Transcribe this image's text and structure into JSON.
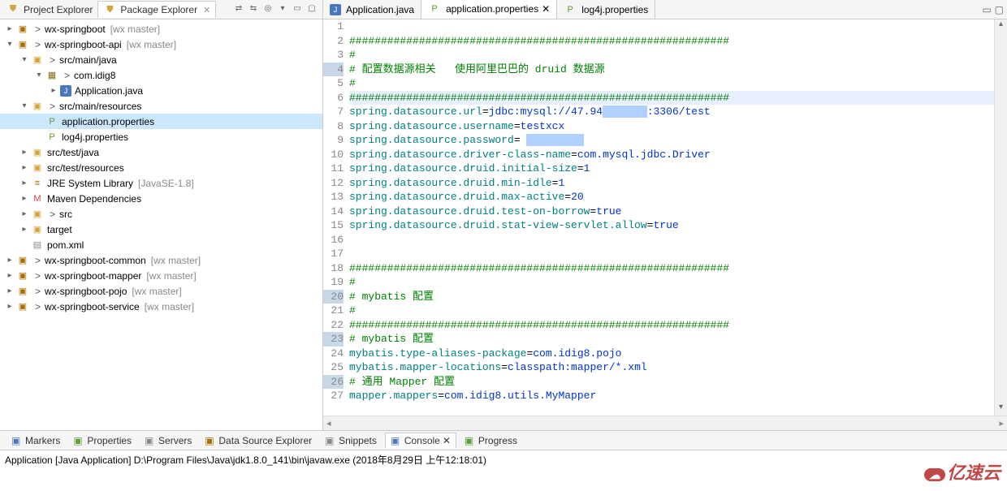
{
  "explorer": {
    "tabs": [
      {
        "label": "Project Explorer",
        "active": false
      },
      {
        "label": "Package Explorer",
        "active": true
      }
    ],
    "tree": [
      {
        "level": 0,
        "exp": "▸",
        "icon": "project",
        "gt": true,
        "label": "wx-springboot",
        "suffix": "[wx master]"
      },
      {
        "level": 0,
        "exp": "▾",
        "icon": "project",
        "gt": true,
        "label": "wx-springboot-api",
        "suffix": "[wx master]"
      },
      {
        "level": 1,
        "exp": "▾",
        "icon": "folder",
        "gt": true,
        "label": "src/main/java",
        "suffix": ""
      },
      {
        "level": 2,
        "exp": "▾",
        "icon": "package",
        "gt": true,
        "label": "com.idig8",
        "suffix": ""
      },
      {
        "level": 3,
        "exp": "▸",
        "icon": "java",
        "gt": false,
        "label": "Application.java",
        "suffix": ""
      },
      {
        "level": 1,
        "exp": "▾",
        "icon": "folder",
        "gt": true,
        "label": "src/main/resources",
        "suffix": ""
      },
      {
        "level": 2,
        "exp": "",
        "icon": "props",
        "gt": false,
        "label": "application.properties",
        "suffix": "",
        "selected": true
      },
      {
        "level": 2,
        "exp": "",
        "icon": "props",
        "gt": false,
        "label": "log4j.properties",
        "suffix": ""
      },
      {
        "level": 1,
        "exp": "▸",
        "icon": "folder",
        "gt": false,
        "label": "src/test/java",
        "suffix": ""
      },
      {
        "level": 1,
        "exp": "▸",
        "icon": "folder",
        "gt": false,
        "label": "src/test/resources",
        "suffix": ""
      },
      {
        "level": 1,
        "exp": "▸",
        "icon": "jre",
        "gt": false,
        "label": "JRE System Library",
        "suffix": "[JavaSE-1.8]"
      },
      {
        "level": 1,
        "exp": "▸",
        "icon": "maven",
        "gt": false,
        "label": "Maven Dependencies",
        "suffix": ""
      },
      {
        "level": 1,
        "exp": "▸",
        "icon": "folder",
        "gt": true,
        "label": "src",
        "suffix": ""
      },
      {
        "level": 1,
        "exp": "▸",
        "icon": "folder",
        "gt": false,
        "label": "target",
        "suffix": ""
      },
      {
        "level": 1,
        "exp": "",
        "icon": "xml",
        "gt": false,
        "label": "pom.xml",
        "suffix": ""
      },
      {
        "level": 0,
        "exp": "▸",
        "icon": "project",
        "gt": true,
        "label": "wx-springboot-common",
        "suffix": "[wx master]"
      },
      {
        "level": 0,
        "exp": "▸",
        "icon": "project",
        "gt": true,
        "label": "wx-springboot-mapper",
        "suffix": "[wx master]"
      },
      {
        "level": 0,
        "exp": "▸",
        "icon": "project",
        "gt": true,
        "label": "wx-springboot-pojo",
        "suffix": "[wx master]"
      },
      {
        "level": 0,
        "exp": "▸",
        "icon": "project",
        "gt": true,
        "label": "wx-springboot-service",
        "suffix": "[wx master]"
      }
    ]
  },
  "editor": {
    "tabs": [
      {
        "label": "Application.java",
        "icon": "java",
        "active": false
      },
      {
        "label": "application.properties",
        "icon": "props",
        "active": true
      },
      {
        "label": "log4j.properties",
        "icon": "props",
        "active": false
      }
    ],
    "lines": [
      {
        "n": 1,
        "hl": false,
        "segs": []
      },
      {
        "n": 2,
        "hl": false,
        "segs": [
          {
            "c": "green",
            "t": "############################################################"
          }
        ]
      },
      {
        "n": 3,
        "hl": false,
        "segs": [
          {
            "c": "green",
            "t": "#"
          }
        ]
      },
      {
        "n": 4,
        "hl": true,
        "segs": [
          {
            "c": "green",
            "t": "# 配置数据源相关   使用阿里巴巴的 druid 数据源"
          }
        ]
      },
      {
        "n": 5,
        "hl": false,
        "segs": [
          {
            "c": "green",
            "t": "#"
          }
        ]
      },
      {
        "n": 6,
        "hl": false,
        "active": true,
        "segs": [
          {
            "c": "green",
            "t": "############################################################"
          }
        ]
      },
      {
        "n": 7,
        "hl": false,
        "segs": [
          {
            "c": "teal",
            "t": "spring.datasource.url"
          },
          {
            "c": "black",
            "t": "="
          },
          {
            "c": "blue",
            "t": "jdbc:mysql://47.94"
          },
          {
            "c": "redacted",
            "t": "xxxxxxx"
          },
          {
            "c": "blue",
            "t": ":3306/test"
          }
        ]
      },
      {
        "n": 8,
        "hl": false,
        "segs": [
          {
            "c": "teal",
            "t": "spring.datasource.username"
          },
          {
            "c": "black",
            "t": "="
          },
          {
            "c": "blue",
            "t": "testxcx"
          }
        ]
      },
      {
        "n": 9,
        "hl": false,
        "segs": [
          {
            "c": "teal",
            "t": "spring.datasource.password"
          },
          {
            "c": "black",
            "t": "= "
          },
          {
            "c": "redacted",
            "t": "xxxxxxxxx"
          }
        ]
      },
      {
        "n": 10,
        "hl": false,
        "segs": [
          {
            "c": "teal",
            "t": "spring.datasource.driver-class-name"
          },
          {
            "c": "black",
            "t": "="
          },
          {
            "c": "blue",
            "t": "com.mysql.jdbc.Driver"
          }
        ]
      },
      {
        "n": 11,
        "hl": false,
        "segs": [
          {
            "c": "teal",
            "t": "spring.datasource.druid.initial-size"
          },
          {
            "c": "black",
            "t": "="
          },
          {
            "c": "blue",
            "t": "1"
          }
        ]
      },
      {
        "n": 12,
        "hl": false,
        "segs": [
          {
            "c": "teal",
            "t": "spring.datasource.druid.min-idle"
          },
          {
            "c": "black",
            "t": "="
          },
          {
            "c": "blue",
            "t": "1"
          }
        ]
      },
      {
        "n": 13,
        "hl": false,
        "segs": [
          {
            "c": "teal",
            "t": "spring.datasource.druid.max-active"
          },
          {
            "c": "black",
            "t": "="
          },
          {
            "c": "blue",
            "t": "20"
          }
        ]
      },
      {
        "n": 14,
        "hl": false,
        "segs": [
          {
            "c": "teal",
            "t": "spring.datasource.druid.test-on-borrow"
          },
          {
            "c": "black",
            "t": "="
          },
          {
            "c": "blue",
            "t": "true"
          }
        ]
      },
      {
        "n": 15,
        "hl": false,
        "segs": [
          {
            "c": "teal",
            "t": "spring.datasource.druid.stat-view-servlet.allow"
          },
          {
            "c": "black",
            "t": "="
          },
          {
            "c": "blue",
            "t": "true"
          }
        ]
      },
      {
        "n": 16,
        "hl": false,
        "segs": []
      },
      {
        "n": 17,
        "hl": false,
        "segs": []
      },
      {
        "n": 18,
        "hl": false,
        "segs": [
          {
            "c": "green",
            "t": "############################################################"
          }
        ]
      },
      {
        "n": 19,
        "hl": false,
        "segs": [
          {
            "c": "green",
            "t": "#"
          }
        ]
      },
      {
        "n": 20,
        "hl": true,
        "segs": [
          {
            "c": "green",
            "t": "# mybatis 配置"
          }
        ]
      },
      {
        "n": 21,
        "hl": false,
        "segs": [
          {
            "c": "green",
            "t": "#"
          }
        ]
      },
      {
        "n": 22,
        "hl": false,
        "segs": [
          {
            "c": "green",
            "t": "############################################################"
          }
        ]
      },
      {
        "n": 23,
        "hl": true,
        "segs": [
          {
            "c": "green",
            "t": "# mybatis 配置"
          }
        ]
      },
      {
        "n": 24,
        "hl": false,
        "segs": [
          {
            "c": "teal",
            "t": "mybatis.type-aliases-package"
          },
          {
            "c": "black",
            "t": "="
          },
          {
            "c": "blue",
            "t": "com.idig8.pojo"
          }
        ]
      },
      {
        "n": 25,
        "hl": false,
        "segs": [
          {
            "c": "teal",
            "t": "mybatis.mapper-locations"
          },
          {
            "c": "black",
            "t": "="
          },
          {
            "c": "blue",
            "t": "classpath:mapper/*.xml"
          }
        ]
      },
      {
        "n": 26,
        "hl": true,
        "segs": [
          {
            "c": "green",
            "t": "# 通用 Mapper 配置"
          }
        ]
      },
      {
        "n": 27,
        "hl": false,
        "segs": [
          {
            "c": "teal",
            "t": "mapper.mappers"
          },
          {
            "c": "black",
            "t": "="
          },
          {
            "c": "blue",
            "t": "com.idig8.utils.MyMapper"
          }
        ]
      }
    ]
  },
  "bottom": {
    "tabs": [
      {
        "label": "Markers",
        "iconCls": "bi-markers"
      },
      {
        "label": "Properties",
        "iconCls": "bi-props"
      },
      {
        "label": "Servers",
        "iconCls": "bi-servers"
      },
      {
        "label": "Data Source Explorer",
        "iconCls": "bi-dse"
      },
      {
        "label": "Snippets",
        "iconCls": "bi-snippets"
      },
      {
        "label": "Console",
        "iconCls": "bi-console",
        "active": true
      },
      {
        "label": "Progress",
        "iconCls": "bi-progress"
      }
    ],
    "console_text": "Application [Java Application] D:\\Program Files\\Java\\jdk1.8.0_141\\bin\\javaw.exe (2018年8月29日 上午12:18:01)"
  },
  "watermark": "亿速云"
}
